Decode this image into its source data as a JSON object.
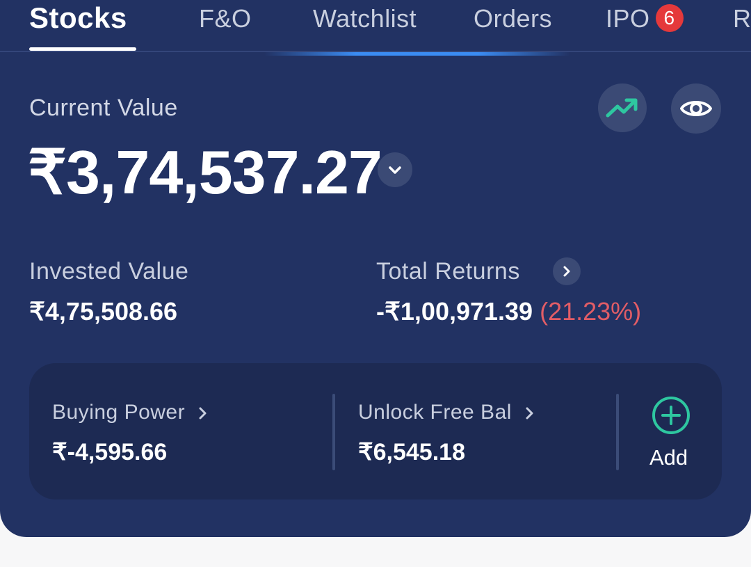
{
  "tabs": [
    {
      "label": "Stocks",
      "active": true
    },
    {
      "label": "F&O"
    },
    {
      "label": "Watchlist"
    },
    {
      "label": "Orders"
    },
    {
      "label": "IPO",
      "badge": "6"
    },
    {
      "label": "R"
    }
  ],
  "summary": {
    "current_value_label": "Current Value",
    "current_value": "₹3,74,537.27",
    "invested_label": "Invested Value",
    "invested_value": "₹4,75,508.66",
    "returns_label": "Total Returns",
    "returns_value": "-₹1,00,971.39",
    "returns_pct": "(21.23%)"
  },
  "funds": {
    "buying_power_label": "Buying Power",
    "buying_power_value": "₹-4,595.66",
    "unlock_label": "Unlock Free Bal",
    "unlock_value": "₹6,545.18",
    "add_label": "Add"
  },
  "icons": {
    "trend": "trending-up-icon",
    "eye": "eye-icon",
    "dropdown": "chevron-down-icon",
    "returns_arrow": "chevron-right-icon",
    "add": "plus-circle-icon"
  },
  "colors": {
    "card_bg": "#223263",
    "panel_bg": "#1d2a53",
    "accent_green": "#2ec7a0",
    "loss_red": "#e25d66",
    "badge_red": "#e5393b",
    "indicator_blue": "#3b8cf3"
  }
}
